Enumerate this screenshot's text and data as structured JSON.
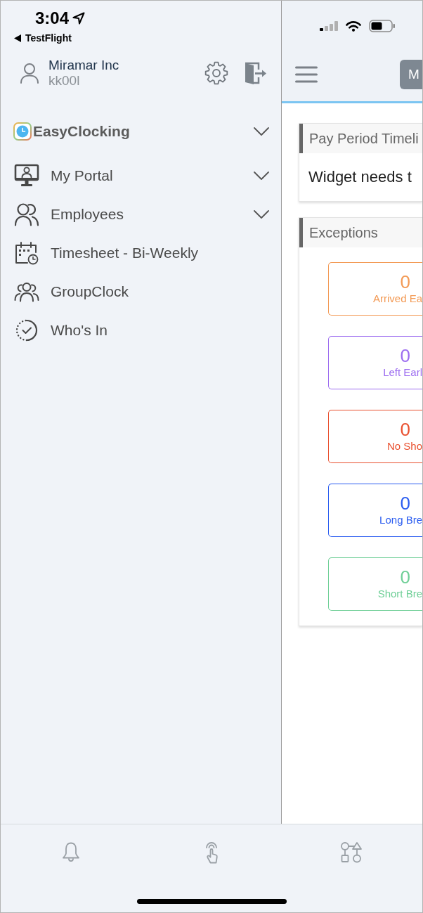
{
  "status_bar": {
    "time": "3:04",
    "back_label": "TestFlight"
  },
  "drawer": {
    "account": {
      "company": "Miramar Inc",
      "username": "kk00l"
    },
    "brand": {
      "name": "EasyClocking",
      "expanded": false
    },
    "menu": [
      {
        "label": "My Portal",
        "kind": "group",
        "expanded": false
      },
      {
        "label": "Employees",
        "kind": "group",
        "expanded": false
      },
      {
        "label": "Timesheet - Bi-Weekly",
        "kind": "link"
      },
      {
        "label": "GroupClock",
        "kind": "link"
      },
      {
        "label": "Who's In",
        "kind": "link"
      }
    ]
  },
  "main": {
    "header_button": "M",
    "cards": [
      {
        "kind": "message",
        "title": "Pay Period Timeli",
        "body": "Widget needs t"
      },
      {
        "kind": "tiles",
        "title": "Exceptions",
        "tiles": [
          {
            "count": "0",
            "label": "Arrived Ea",
            "color": "#f39a55"
          },
          {
            "count": "0",
            "label": "Left Earl",
            "color": "#9c6cf0"
          },
          {
            "count": "0",
            "label": "No Sho",
            "color": "#e9502f"
          },
          {
            "count": "0",
            "label": "Long Bre",
            "color": "#2a5cf0"
          },
          {
            "count": "0",
            "label": "Short Bre",
            "color": "#6fcf97"
          }
        ]
      }
    ]
  }
}
